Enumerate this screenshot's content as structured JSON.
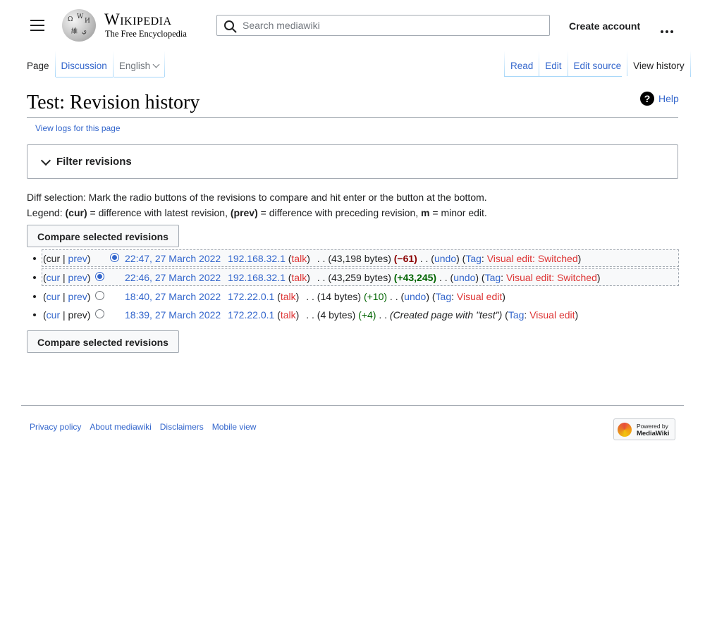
{
  "header": {
    "logo_word": "Wikipedia",
    "logo_tagline": "The Free Encyclopedia",
    "search_placeholder": "Search mediawiki",
    "create_account": "Create account"
  },
  "tabs": {
    "page": "Page",
    "discussion": "Discussion",
    "language": "English",
    "read": "Read",
    "edit": "Edit",
    "edit_source": "Edit source",
    "view_history": "View history"
  },
  "title": "Test: Revision history",
  "help": "Help",
  "view_logs": "View logs for this page",
  "filter_label": "Filter revisions",
  "explanation": {
    "line1": "Diff selection: Mark the radio buttons of the revisions to compare and hit enter or the button at the bottom.",
    "legend_prefix": "Legend: ",
    "cur": "(cur)",
    "cur_desc": " = difference with latest revision, ",
    "prev": "(prev)",
    "prev_desc": " = difference with preceding revision, ",
    "m": "m",
    "m_desc": " = minor edit."
  },
  "compare_button": "Compare selected revisions",
  "revisions": [
    {
      "cur": "cur",
      "prev": "prev",
      "date": "22:47, 27 March 2022",
      "user": "192.168.32.1",
      "talk": "talk",
      "bytes": "43,198 bytes",
      "diff": "−61",
      "undo": "undo",
      "tag": "Tag",
      "tags": "Visual edit: Switched"
    },
    {
      "cur": "cur",
      "prev": "prev",
      "date": "22:46, 27 March 2022",
      "user": "192.168.32.1",
      "talk": "talk",
      "bytes": "43,259 bytes",
      "diff": "+43,245",
      "undo": "undo",
      "tag": "Tag",
      "tags": "Visual edit: Switched"
    },
    {
      "cur": "cur",
      "prev": "prev",
      "date": "18:40, 27 March 2022",
      "user": "172.22.0.1",
      "talk": "talk",
      "bytes": "14 bytes",
      "diff": "+10",
      "undo": "undo",
      "tag": "Tag",
      "tags": "Visual edit"
    },
    {
      "cur": "cur",
      "prev": "prev",
      "date": "18:39, 27 March 2022",
      "user": "172.22.0.1",
      "talk": "talk",
      "bytes": "4 bytes",
      "diff": "+4",
      "summary": "(Created page with \"test\")",
      "tag": "Tag",
      "tags": "Visual edit"
    }
  ],
  "footer": {
    "privacy": "Privacy policy",
    "about": "About mediawiki",
    "disclaimers": "Disclaimers",
    "mobile": "Mobile view",
    "powered_line1": "Powered by",
    "powered_line2": "MediaWiki"
  },
  "colors": {
    "link": "#3366cc",
    "redlink": "#d33",
    "negative": "#8b0000",
    "positive": "#006400"
  },
  "icons": [
    "menu-icon",
    "search-icon",
    "more-icon",
    "help-icon",
    "chevron-down-icon"
  ]
}
